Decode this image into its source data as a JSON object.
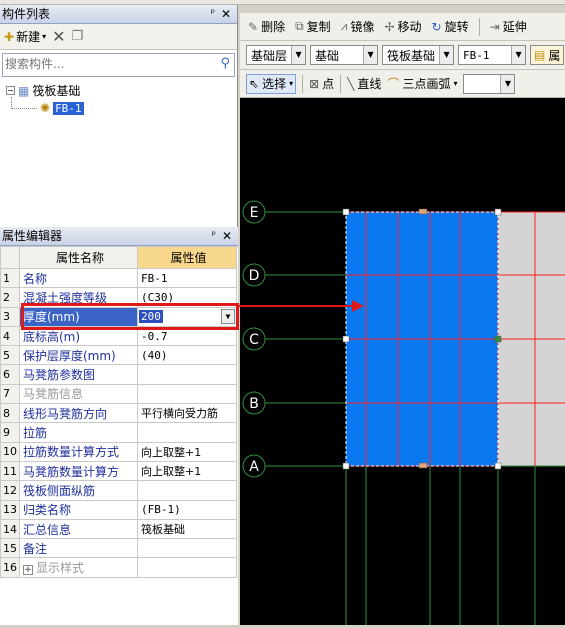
{
  "left_panel": {
    "component_list_title": "构件列表",
    "toolbar": {
      "new_label": "新建"
    },
    "search": {
      "placeholder": "搜索构件..."
    },
    "tree": {
      "root": "筏板基础",
      "child": "FB-1"
    }
  },
  "property_editor": {
    "title": "属性编辑器",
    "col_name": "属性名称",
    "col_value": "属性值",
    "rows": [
      {
        "no": "1",
        "name": "名称",
        "value": "FB-1",
        "style": "blue"
      },
      {
        "no": "2",
        "name": "混凝土强度等级",
        "value": "(C30)",
        "style": "blue"
      },
      {
        "no": "3",
        "name": "厚度(mm)",
        "value": "200",
        "style": "selected"
      },
      {
        "no": "4",
        "name": "底标高(m)",
        "value": "-0.7",
        "style": "blue"
      },
      {
        "no": "5",
        "name": "保护层厚度(mm)",
        "value": "(40)",
        "style": "normal"
      },
      {
        "no": "6",
        "name": "马凳筋参数图",
        "value": "",
        "style": "normal"
      },
      {
        "no": "7",
        "name": "马凳筋信息",
        "value": "",
        "style": "gray"
      },
      {
        "no": "8",
        "name": "线形马凳筋方向",
        "value": "平行横向受力筋",
        "style": "normal"
      },
      {
        "no": "9",
        "name": "拉筋",
        "value": "",
        "style": "normal"
      },
      {
        "no": "10",
        "name": "拉筋数量计算方式",
        "value": "向上取整+1",
        "style": "normal"
      },
      {
        "no": "11",
        "name": "马凳筋数量计算方",
        "value": "向上取整+1",
        "style": "normal"
      },
      {
        "no": "12",
        "name": "筏板侧面纵筋",
        "value": "",
        "style": "normal"
      },
      {
        "no": "13",
        "name": "归类名称",
        "value": "(FB-1)",
        "style": "normal"
      },
      {
        "no": "14",
        "name": "汇总信息",
        "value": "筏板基础",
        "style": "normal"
      },
      {
        "no": "15",
        "name": "备注",
        "value": "",
        "style": "normal"
      },
      {
        "no": "16",
        "name": "显示样式",
        "value": "",
        "style": "gray-expand"
      }
    ]
  },
  "edit_toolbar": {
    "delete": "删除",
    "copy": "复制",
    "mirror": "镜像",
    "move": "移动",
    "rotate": "旋转",
    "extend": "延伸"
  },
  "layer_toolbar": {
    "floor": "基础层",
    "category": "基础",
    "type": "筏板基础",
    "component": "FB-1",
    "extra": "属"
  },
  "draw_toolbar": {
    "select": "选择",
    "point": "点",
    "line": "直线",
    "arc": "三点画弧"
  },
  "axes": {
    "labels": [
      "E",
      "D",
      "C",
      "B",
      "A"
    ]
  },
  "colors": {
    "slab": "#0a78f0",
    "grid_green": "#2f8f3a",
    "grid_red": "#ff1f1f",
    "highlight": "#e01818"
  }
}
